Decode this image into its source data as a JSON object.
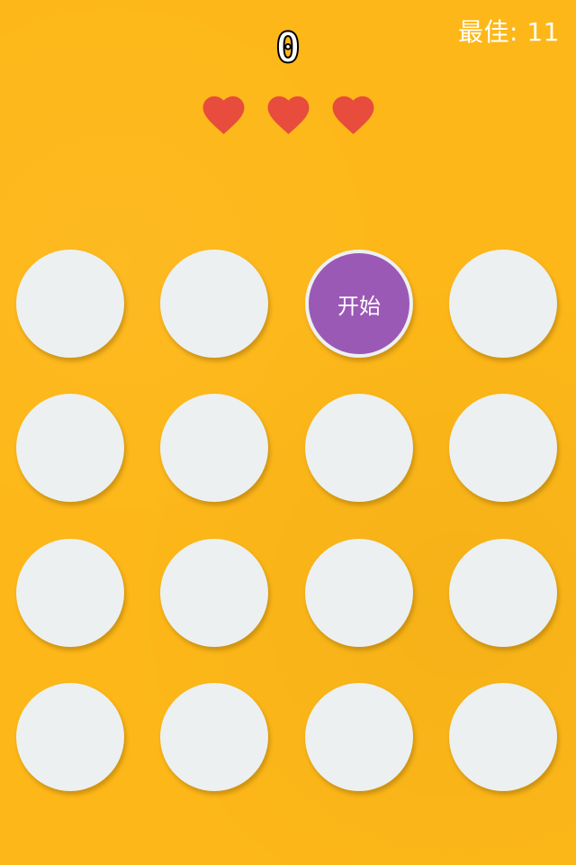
{
  "header": {
    "best_label": "最佳: 11",
    "score": "0"
  },
  "lives": {
    "count": 3,
    "icon": "heart-icon",
    "color": "#E74C3C"
  },
  "board": {
    "rows": 4,
    "cols": 4,
    "cell_color": "#ECF0F1",
    "start_cell": {
      "row": 0,
      "col": 2,
      "label": "开始",
      "color": "#9B59B6"
    }
  },
  "theme": {
    "background": "#FDB718",
    "text_color": "#FFFFFF"
  }
}
